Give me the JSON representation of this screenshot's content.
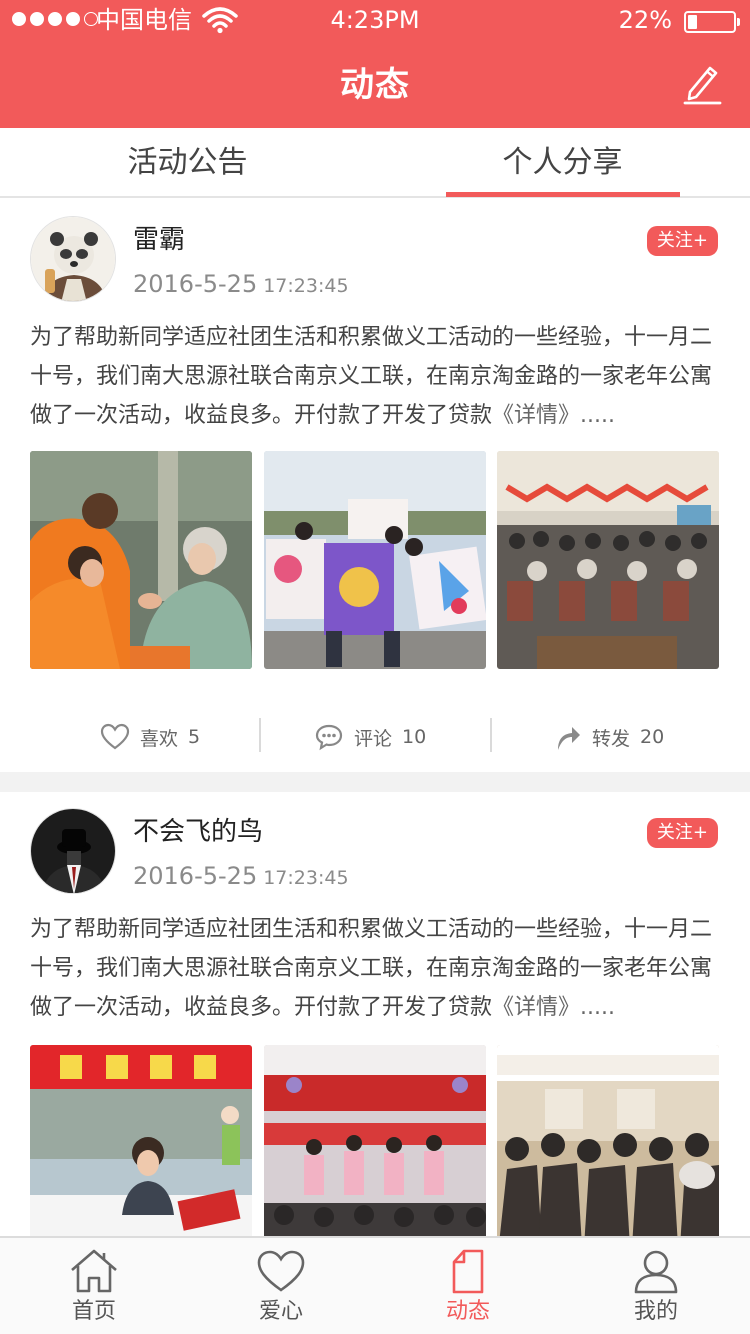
{
  "status_bar": {
    "carrier": "中国电信",
    "time": "4:23PM",
    "battery": "22%"
  },
  "header": {
    "title": "动态",
    "edit_icon": "pencil-icon"
  },
  "tabs": [
    {
      "label": "活动公告",
      "active": false
    },
    {
      "label": "个人分享",
      "active": true
    }
  ],
  "posts": [
    {
      "username": "雷霸",
      "date": "2016-5-25",
      "time": "17:23:45",
      "follow_label": "关注+",
      "text": "为了帮助新同学适应社团生活和积累做义工活动的一些经验，十一月二十号，我们南大思源社联合南京义工联，在南京淘金路的一家老年公寓做了一次活动，收益良多。开付款了开发了贷款",
      "more": "《详情》.....",
      "like_label": "喜欢",
      "like_count": "5",
      "comment_label": "评论",
      "comment_count": "10",
      "share_label": "转发",
      "share_count": "20"
    },
    {
      "username": "不会飞的鸟",
      "date": "2016-5-25",
      "time": "17:23:45",
      "follow_label": "关注+",
      "text": "为了帮助新同学适应社团生活和积累做义工活动的一些经验，十一月二十号，我们南大思源社联合南京义工联，在南京淘金路的一家老年公寓做了一次活动，收益良多。开付款了开发了贷款",
      "more": "《详情》....."
    }
  ],
  "bottom_nav": [
    {
      "label": "首页",
      "icon": "home-icon",
      "active": false
    },
    {
      "label": "爱心",
      "icon": "heart-icon",
      "active": false
    },
    {
      "label": "动态",
      "icon": "document-icon",
      "active": true
    },
    {
      "label": "我的",
      "icon": "user-icon",
      "active": false
    }
  ],
  "colors": {
    "accent": "#f25a5a",
    "text": "#444444",
    "muted": "#8a8a8a"
  }
}
